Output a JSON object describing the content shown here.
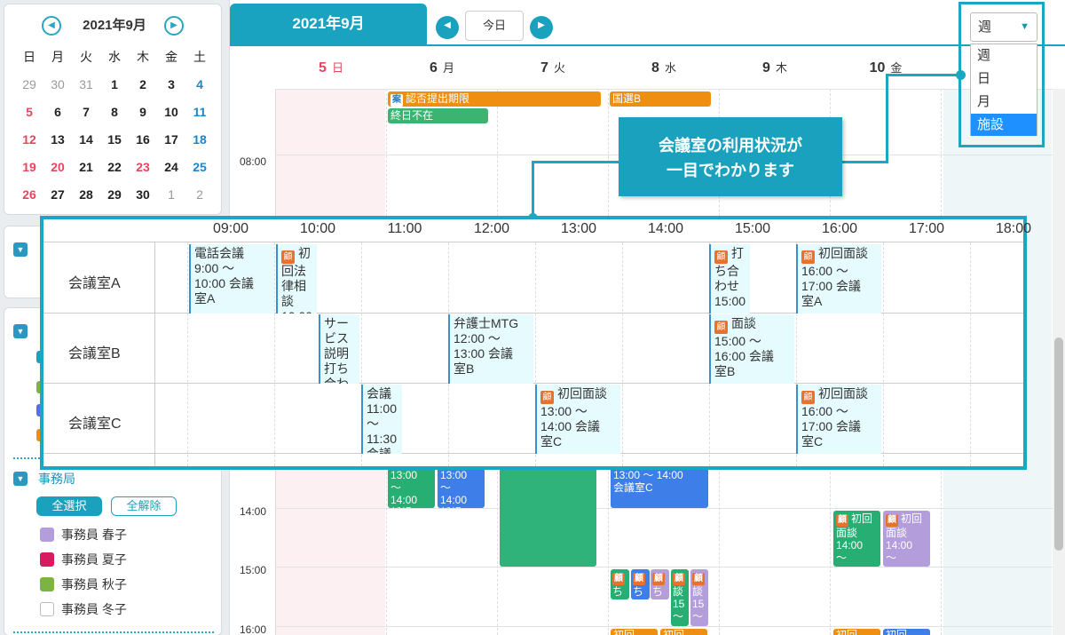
{
  "mini_calendar": {
    "title": "2021年9月",
    "prev_icon": "chevron-left-icon",
    "next_icon": "chevron-right-icon",
    "weekdays": [
      "日",
      "月",
      "火",
      "水",
      "木",
      "金",
      "土"
    ],
    "weeks": [
      [
        "29",
        "30",
        "31",
        "1",
        "2",
        "3",
        "4"
      ],
      [
        "5",
        "6",
        "7",
        "8",
        "9",
        "10",
        "11"
      ],
      [
        "12",
        "13",
        "14",
        "15",
        "16",
        "17",
        "18"
      ],
      [
        "19",
        "20",
        "21",
        "22",
        "23",
        "24",
        "25"
      ],
      [
        "26",
        "27",
        "28",
        "29",
        "30",
        "1",
        "2"
      ]
    ]
  },
  "sidebar": {
    "group_label": "事務局",
    "select_all": "全選択",
    "clear_all": "全解除",
    "members": [
      {
        "name": "事務員 春子",
        "color": "#b39ddb"
      },
      {
        "name": "事務員 夏子",
        "color": "#d81b60"
      },
      {
        "name": "事務員 秋子",
        "color": "#7cb342"
      },
      {
        "name": "事務員 冬子",
        "color": "#ffffff"
      }
    ]
  },
  "toolbar": {
    "month_tab": "2021年9月",
    "today_label": "今日"
  },
  "view_select": {
    "selected": "週",
    "options": [
      "週",
      "日",
      "月",
      "施設"
    ],
    "highlighted": "施設"
  },
  "week_header": [
    {
      "day": "5",
      "dow": "日"
    },
    {
      "day": "6",
      "dow": "月"
    },
    {
      "day": "7",
      "dow": "火"
    },
    {
      "day": "8",
      "dow": "水"
    },
    {
      "day": "9",
      "dow": "木"
    },
    {
      "day": "10",
      "dow": "金"
    }
  ],
  "week_times": [
    "08:00",
    "14:00",
    "15:00",
    "16:00"
  ],
  "week_events": {
    "allday1": "認否提出期限",
    "allday2": "終日不在",
    "allday3": "国選B",
    "e1": "13:00\n～\n14:00\n新規",
    "e2": "13:00\n～\n14:00\n新規",
    "e3": "13:00 ～ 14:00\n会議室C",
    "e4": "初回\n面談\n14:00\n～",
    "e5": "初回\n面談\n14:00\n～",
    "e6": "ち",
    "e7": "ち",
    "e8": "ち",
    "e9": "談\n15\n～",
    "e10": "談\n15\n～",
    "e11": "初回",
    "e12": "初回",
    "e13": "初回",
    "e14": "初回"
  },
  "callout": {
    "line1": "会議室の利用状況が",
    "line2": "一目でわかります"
  },
  "facility": {
    "hours": [
      "09:00",
      "10:00",
      "11:00",
      "12:00",
      "13:00",
      "14:00",
      "15:00",
      "16:00",
      "17:00",
      "18:00"
    ],
    "rooms": [
      "会議室A",
      "会議室B",
      "会議室C"
    ],
    "events": {
      "a1": "電話会議\n9:00 ～\n10:00 会議\n室A",
      "a2": "初\n回法\n律相\n談\n10:00",
      "a3": "打\nち合\nわせ\n15:00",
      "a4": "初回面談\n16:00 ～\n17:00 会議\n室A",
      "b1": "サー\nビス\n説明\n打ち\n合わ",
      "b2": "弁護士MTG\n12:00 ～\n13:00 会議\n室B",
      "b3": "面談\n15:00 ～\n16:00 会議\n室B",
      "c1": "会議\n11:00\n ～\n11:30\n会議",
      "c2": "初回面談\n13:00 ～\n14:00 会議\n室C",
      "c3": "初回面談\n16:00 ～\n17:00 会議\n室C"
    }
  }
}
